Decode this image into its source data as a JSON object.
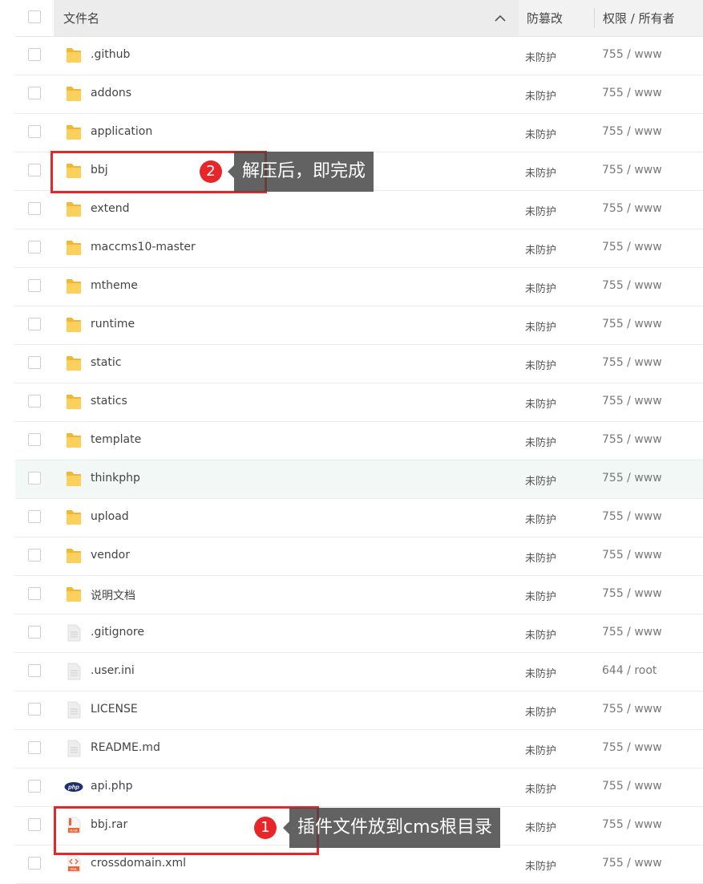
{
  "header": {
    "name_label": "文件名",
    "protection_label": "防篡改",
    "permission_label": "权限 / 所有者"
  },
  "rows": [
    {
      "name": ".github",
      "type": "folder",
      "protection": "未防护",
      "permission": "755 / www"
    },
    {
      "name": "addons",
      "type": "folder",
      "protection": "未防护",
      "permission": "755 / www"
    },
    {
      "name": "application",
      "type": "folder",
      "protection": "未防护",
      "permission": "755 / www"
    },
    {
      "name": "bbj",
      "type": "folder",
      "protection": "未防护",
      "permission": "755 / www"
    },
    {
      "name": "extend",
      "type": "folder",
      "protection": "未防护",
      "permission": "755 / www"
    },
    {
      "name": "maccms10-master",
      "type": "folder",
      "protection": "未防护",
      "permission": "755 / www"
    },
    {
      "name": "mtheme",
      "type": "folder",
      "protection": "未防护",
      "permission": "755 / www"
    },
    {
      "name": "runtime",
      "type": "folder",
      "protection": "未防护",
      "permission": "755 / www"
    },
    {
      "name": "static",
      "type": "folder",
      "protection": "未防护",
      "permission": "755 / www"
    },
    {
      "name": "statics",
      "type": "folder",
      "protection": "未防护",
      "permission": "755 / www"
    },
    {
      "name": "template",
      "type": "folder",
      "protection": "未防护",
      "permission": "755 / www"
    },
    {
      "name": "thinkphp",
      "type": "folder",
      "protection": "未防护",
      "permission": "755 / www"
    },
    {
      "name": "upload",
      "type": "folder",
      "protection": "未防护",
      "permission": "755 / www"
    },
    {
      "name": "vendor",
      "type": "folder",
      "protection": "未防护",
      "permission": "755 / www"
    },
    {
      "name": "说明文档",
      "type": "folder",
      "protection": "未防护",
      "permission": "755 / www"
    },
    {
      "name": ".gitignore",
      "type": "file",
      "protection": "未防护",
      "permission": "755 / www"
    },
    {
      "name": ".user.ini",
      "type": "file",
      "protection": "未防护",
      "permission": "644 / root"
    },
    {
      "name": "LICENSE",
      "type": "file",
      "protection": "未防护",
      "permission": "755 / www"
    },
    {
      "name": "README.md",
      "type": "file",
      "protection": "未防护",
      "permission": "755 / www"
    },
    {
      "name": "api.php",
      "type": "php",
      "protection": "未防护",
      "permission": "755 / www"
    },
    {
      "name": "bbj.rar",
      "type": "rar",
      "protection": "未防护",
      "permission": "755 / www"
    },
    {
      "name": "crossdomain.xml",
      "type": "xml",
      "protection": "未防护",
      "permission": "755 / www"
    }
  ],
  "icons": {
    "php_label": "php",
    "rar_label": "RAR",
    "xml_label": "XML"
  },
  "annotations": [
    {
      "number": "2",
      "text": "解压后，即完成"
    },
    {
      "number": "1",
      "text": "插件文件放到cms根目录"
    }
  ],
  "colors": {
    "accent_red": "#e8262a",
    "folder": "#f7c948",
    "hover_row": "#f1f8f6"
  }
}
